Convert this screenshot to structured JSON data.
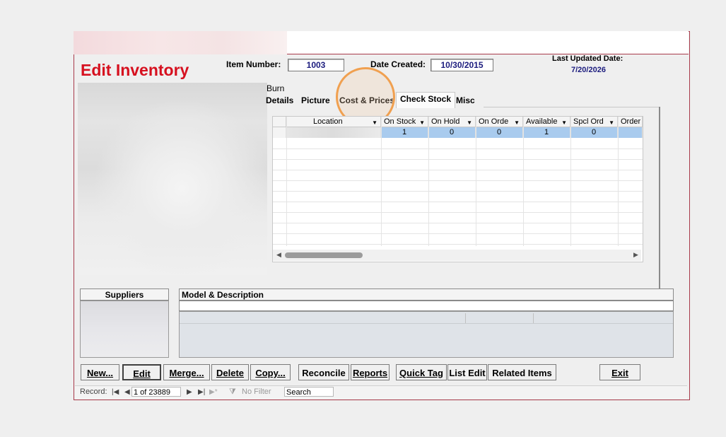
{
  "form": {
    "title": "Edit Inventory",
    "item_number_label": "Item Number:",
    "item_number": "1003",
    "date_created_label": "Date Created:",
    "date_created": "10/30/2015",
    "last_updated_label": "Last Updated Date:",
    "last_updated": "7/20/2026",
    "partial_text": "Burn"
  },
  "tabs": [
    {
      "label": "Details",
      "active": false
    },
    {
      "label": "Picture",
      "active": false
    },
    {
      "label": "Cost & Prices",
      "active": false
    },
    {
      "label": "Check Stock",
      "active": true
    },
    {
      "label": "Misc",
      "active": false
    }
  ],
  "grid": {
    "columns": [
      "Location",
      "On Stock",
      "On Hold",
      "On Orde",
      "Available",
      "Spcl Ord",
      "Order"
    ],
    "rows": [
      [
        "",
        "1",
        "0",
        "0",
        "1",
        "0",
        ""
      ]
    ]
  },
  "suppliers_label": "Suppliers",
  "model_description_label": "Model & Description",
  "buttons": {
    "new": "New...",
    "edit": "Edit",
    "merge": "Merge...",
    "delete": "Delete",
    "copy": "Copy...",
    "reconcile": "Reconcile",
    "reports": "Reports",
    "quick_tag": "Quick Tag",
    "list_edit": "List Edit",
    "related_items": "Related Items",
    "exit": "Exit"
  },
  "record_nav": {
    "label": "Record:",
    "position": "1 of 23889",
    "filter": "No Filter",
    "search_placeholder": "Search"
  },
  "colors": {
    "title_red": "#d6101f",
    "value_navy": "#1c1c7e",
    "highlight_circle": "#f0a050",
    "selected_row": "#a9cbee"
  }
}
